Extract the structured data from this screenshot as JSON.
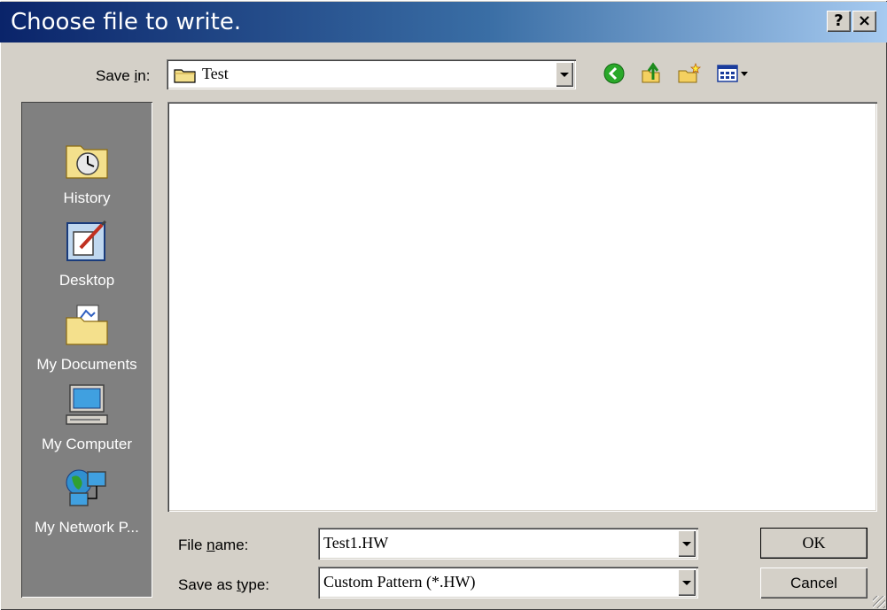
{
  "dialog": {
    "title": "Choose file to write.",
    "help_button": "?",
    "close_button": "×"
  },
  "save_in": {
    "label_pre": "Save ",
    "label_mnemonic": "i",
    "label_post": "n:",
    "value": "Test"
  },
  "places": [
    {
      "label": "History",
      "icon": "history-icon"
    },
    {
      "label": "Desktop",
      "icon": "desktop-icon"
    },
    {
      "label": "My Documents",
      "icon": "my-documents-icon"
    },
    {
      "label": "My Computer",
      "icon": "my-computer-icon"
    },
    {
      "label": "My Network P...",
      "icon": "my-network-places-icon"
    }
  ],
  "file_name": {
    "label_pre": "File ",
    "label_mnemonic": "n",
    "label_post": "ame:",
    "value": "Test1.HW"
  },
  "save_as_type": {
    "label_pre": "Save as ",
    "label_mnemonic": "t",
    "label_post": "ype:",
    "value": "Custom Pattern (*.HW)"
  },
  "buttons": {
    "ok": "OK",
    "cancel": "Cancel"
  },
  "colors": {
    "title_start": "#0a246a",
    "title_end": "#a6caf0",
    "face": "#d4d0c8",
    "places_bar": "#808080"
  }
}
